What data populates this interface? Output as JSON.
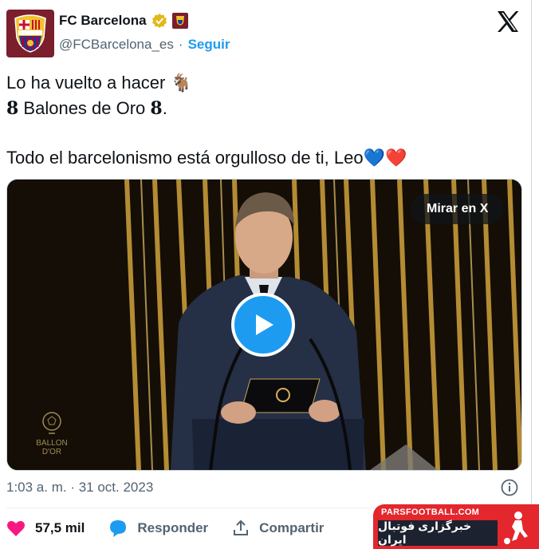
{
  "account": {
    "name": "FC Barcelona",
    "handle": "@FCBarcelona_es",
    "separator": "·",
    "follow_label": "Seguir",
    "avatar_text": "FCB",
    "verified_icon": "verified-gold-badge-icon",
    "brand_color": "#7a1f2b"
  },
  "tweet": {
    "line1": "Lo ha vuelto a hacer 🐐",
    "line2_num_a": "8",
    "line2_text": " Balones de Oro ",
    "line2_num_b": "8",
    "line2_end": ".",
    "line3": "Todo el barcelonismo está orgulloso de ti, Leo💙❤️"
  },
  "media": {
    "watch_label": "Mirar en X",
    "ballon_logo_line1": "BALLON",
    "ballon_logo_line2": "D'OR",
    "play_icon": "play-icon"
  },
  "meta": {
    "timestamp": "1:03 a. m. · 31 oct. 2023"
  },
  "actions": {
    "likes_count": "57,5 mil",
    "reply_label": "Responder",
    "share_label": "Compartir"
  },
  "watermark": {
    "site": "PARSFOOTBALL.COM",
    "tagline": "خبرگزاری فوتبال ایران"
  },
  "colors": {
    "accent": "#1d9bf0",
    "like": "#f91880",
    "text_secondary": "#536471"
  }
}
